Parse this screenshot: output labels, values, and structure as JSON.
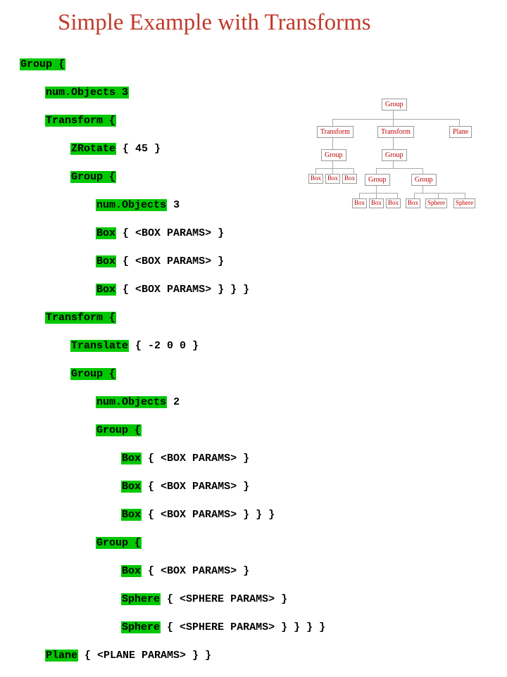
{
  "title": "Simple Example with Transforms",
  "code": {
    "l0_hl": "Group {",
    "l1_hl": "num.Objects 3",
    "l2_hl": "Transform {",
    "l3_hl": "ZRotate",
    "l3_rest": " { 45 }",
    "l4_hl": "Group {",
    "l5_hl": "num.Objects",
    "l5_rest": " 3",
    "l6_hl": "Box",
    "l6_rest": " { <BOX PARAMS> }",
    "l7_hl": "Box",
    "l7_rest": " { <BOX PARAMS> }",
    "l8_hl": "Box",
    "l8_rest": " { <BOX PARAMS> } } }",
    "l9_hl": "Transform {",
    "l10_hl": "Translate",
    "l10_rest": " { -2 0 0 }",
    "l11_hl": "Group {",
    "l12_hl": "num.Objects",
    "l12_rest": " 2",
    "l13_hl": "Group {",
    "l14_hl": "Box",
    "l14_rest": " { <BOX PARAMS> }",
    "l15_hl": "Box",
    "l15_rest": " { <BOX PARAMS> }",
    "l16_hl": "Box",
    "l16_rest": " { <BOX PARAMS> } } }",
    "l17_hl": "Group {",
    "l18_hl": "Box",
    "l18_rest": " { <BOX PARAMS> }",
    "l19_hl": "Sphere",
    "l19_rest": " { <SPHERE PARAMS> }",
    "l20_hl": "Sphere",
    "l20_rest": " { <SPHERE PARAMS> } } } }",
    "l21_hl": "Plane",
    "l21_rest": " { <PLANE PARAMS> } }"
  },
  "diagram": {
    "n0": "Group",
    "n1": "Transform",
    "n2": "Transform",
    "n3": "Plane",
    "n4": "Group",
    "n5": "Box",
    "n6": "Box",
    "n7": "Box",
    "n8": "Group",
    "n9": "Group",
    "n10": "Group",
    "n11": "Box",
    "n12": "Box",
    "n13": "Box",
    "n14": "Box",
    "n15": "Sphere",
    "n16": "Sphere"
  }
}
